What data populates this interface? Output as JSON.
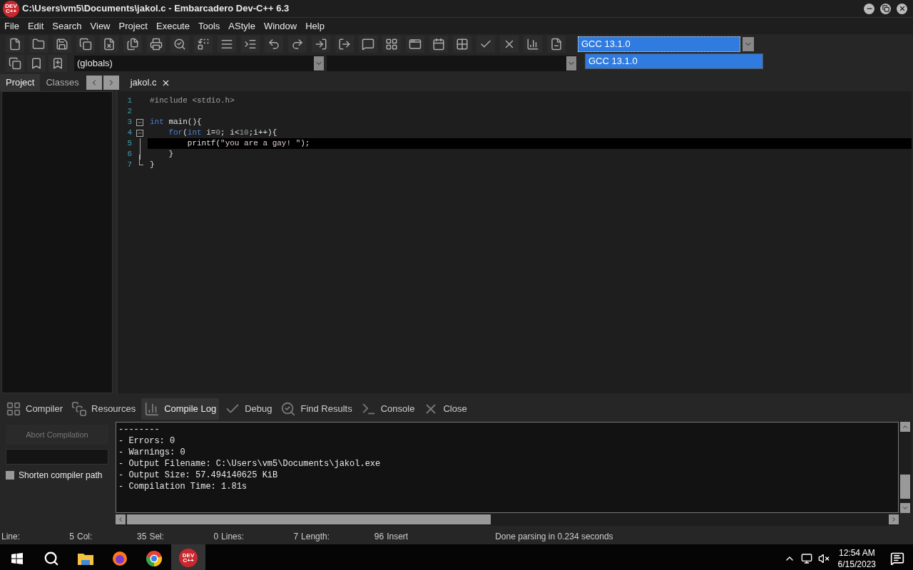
{
  "window": {
    "title": "C:\\Users\\vm5\\Documents\\jakol.c - Embarcadero Dev-C++ 6.3",
    "app_icon": "DEV C++"
  },
  "menu": [
    "File",
    "Edit",
    "Search",
    "View",
    "Project",
    "Execute",
    "Tools",
    "AStyle",
    "Window",
    "Help"
  ],
  "scope_select": {
    "value": "(globals)"
  },
  "compiler_select": {
    "value": "GCC 13.1.0",
    "expanded": true,
    "options": [
      {
        "label": "GCC 13.1.0",
        "selected": true
      }
    ]
  },
  "side_tabs": [
    {
      "label": "Project",
      "selected": true
    },
    {
      "label": "Classes",
      "selected": false
    }
  ],
  "editor_tabs": [
    {
      "label": "jakol.c",
      "selected": true
    }
  ],
  "code": [
    {
      "number": "1",
      "kind": "plain",
      "current": false,
      "tokens": [
        {
          "kind": "directive",
          "text": "#include <stdio.h>"
        }
      ]
    },
    {
      "number": "2",
      "kind": "plain",
      "current": false
    },
    {
      "number": "3",
      "kind": "fold",
      "current": false,
      "tokens": [
        {
          "kind": "keyword",
          "text": "int"
        },
        {
          "kind": "plain",
          "text": " main"
        },
        {
          "kind": "symbol",
          "text": "(){"
        }
      ]
    },
    {
      "number": "4",
      "kind": "fold",
      "current": false,
      "tokens": [
        {
          "kind": "keyword",
          "text": "    for"
        },
        {
          "kind": "symbol",
          "text": "("
        },
        {
          "kind": "keyword",
          "text": "int"
        },
        {
          "kind": "plain",
          "text": " i"
        },
        {
          "kind": "symbol",
          "text": "="
        },
        {
          "kind": "number",
          "text": "0"
        },
        {
          "kind": "symbol",
          "text": ";"
        },
        {
          "kind": "plain",
          "text": " i"
        },
        {
          "kind": "symbol",
          "text": "<"
        },
        {
          "kind": "number",
          "text": "10"
        },
        {
          "kind": "symbol",
          "text": ";"
        },
        {
          "kind": "plain",
          "text": "i"
        },
        {
          "kind": "symbol",
          "text": "++){"
        }
      ]
    },
    {
      "number": "5",
      "kind": "inner",
      "current": true,
      "tokens": [
        {
          "kind": "plain",
          "text": "        printf"
        },
        {
          "kind": "symbol",
          "text": "("
        },
        {
          "kind": "string",
          "text": "\"you are a gay! \""
        },
        {
          "kind": "symbol",
          "text": ");"
        }
      ]
    },
    {
      "number": "6",
      "kind": "inner",
      "current": false,
      "tokens": [
        {
          "kind": "symbol",
          "text": "    }"
        }
      ]
    },
    {
      "number": "7",
      "kind": "end",
      "current": false,
      "tokens": [
        {
          "kind": "symbol",
          "text": "}"
        }
      ]
    }
  ],
  "bottom_tabs": [
    {
      "label": "Compiler",
      "kind": "grid",
      "selected": false
    },
    {
      "label": "Resources",
      "kind": "copy",
      "selected": false
    },
    {
      "label": "Compile Log",
      "kind": "chart",
      "selected": true
    },
    {
      "label": "Debug",
      "kind": "check",
      "selected": false
    },
    {
      "label": "Find Results",
      "kind": "find",
      "selected": false
    },
    {
      "label": "Console",
      "kind": "console",
      "selected": false
    },
    {
      "label": "Close",
      "kind": "close",
      "selected": false
    }
  ],
  "compile_panel": {
    "abort_button": {
      "label": "Abort Compilation",
      "disabled": true
    },
    "shorten_path": {
      "label": "Shorten compiler path",
      "checked": false
    },
    "log": [
      "--------",
      "- Errors: 0",
      "- Warnings: 0",
      "- Output Filename: C:\\Users\\vm5\\Documents\\jakol.exe",
      "- Output Size: 57.494140625 KiB",
      "- Compilation Time: 1.81s"
    ]
  },
  "status_bar": [
    {
      "label": "Line:",
      "value": "5"
    },
    {
      "label": "Col:",
      "value": "35"
    },
    {
      "label": "Sel:",
      "value": "0"
    },
    {
      "label": "Lines:",
      "value": "7"
    },
    {
      "label": "Length:",
      "value": "96"
    },
    {
      "label": "Insert"
    }
  ],
  "status_message": "Done parsing in 0.234 seconds",
  "taskbar": {
    "apps": [
      {
        "kind": "files",
        "active": false
      },
      {
        "kind": "firefox",
        "active": false
      },
      {
        "kind": "chrome",
        "active": false
      },
      {
        "kind": "devcpp",
        "active": true,
        "text": "DEV C++"
      }
    ],
    "time": "12:54 AM",
    "date": "6/15/2023"
  }
}
